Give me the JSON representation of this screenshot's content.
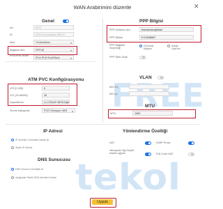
{
  "header": {
    "title": "WAN Arabirimini düzenle",
    "close": "✕"
  },
  "general": {
    "title": "Genel",
    "ad": {
      "label": "Ad",
      "value": "ECO"
    },
    "id": {
      "label": "ID",
      "value": "VPN Enumeration 8ECO"
    },
    "mod": {
      "label": "Mod",
      "value": "Yönlendirme"
    },
    "baglanti": {
      "label": "Bağlantı türü",
      "value": "PPPoE"
    },
    "ipv4ipv6": {
      "label": "IPv4/IPv6 Mode",
      "value": "IPv4-IPv6 DualStack"
    }
  },
  "ppp": {
    "title": "PPP Bilgisi",
    "user": {
      "label": "PPP Kullanıcı Adı",
      "value": "freetekolon@ttnet"
    },
    "pass": {
      "label": "PPP Şifresi",
      "value": "Fr12345667"
    },
    "mode": {
      "label": "PPP Bağlantı Seçeneği",
      "opt1": "Otomatik Bağlanı",
      "opt2": "İsteğe Uyarma"
    },
    "auth": {
      "label": "PPP Şifre Ünalı"
    }
  },
  "atm": {
    "title": "ATM PVC Konfigürasyonu",
    "vpi": {
      "label": "VPI [0-255]",
      "value": "8"
    },
    "vci": {
      "label": "VCI [32-65535]",
      "value": "35"
    },
    "enc": {
      "label": "Kapsülleme",
      "value": "LLC/SNAP-BRIDGING"
    },
    "svc": {
      "label": "Servis Kategorisi",
      "value": "PCR Olmayan UBR"
    }
  },
  "vlan": {
    "title": "VLAN",
    "id": {
      "label": "802.1Q",
      "value": ""
    },
    "pri": {
      "label": "802.1p",
      "value": ""
    }
  },
  "mtu": {
    "title": "MTU",
    "label": "MTU",
    "value": "1492"
  },
  "ip": {
    "title": "IP Adresi",
    "opt1": "IP Adresini Otomatik Olarak Al",
    "opt2": "Statik IP Adresi"
  },
  "routing": {
    "title": "Yönlendirme Özelliği",
    "nat": "NAT",
    "igmp": "IGMP Proxy",
    "defgw": "Varsayılan Ağ Geçidi olarak uygula",
    "fullcone": "Full Cone NAT"
  },
  "dns": {
    "title": "DNS Sunucusu",
    "opt1": "DNS Sunucu Otomatik Al",
    "opt2": "Aşağıdaki Statik DNS Adresini Kullan"
  },
  "footer": {
    "apply": "Uygula"
  },
  "watermark": {
    "line1": "FREE",
    "line2": "tekol"
  },
  "colors": {
    "accent": "#1a73e8",
    "highlight": "#c0192e"
  }
}
